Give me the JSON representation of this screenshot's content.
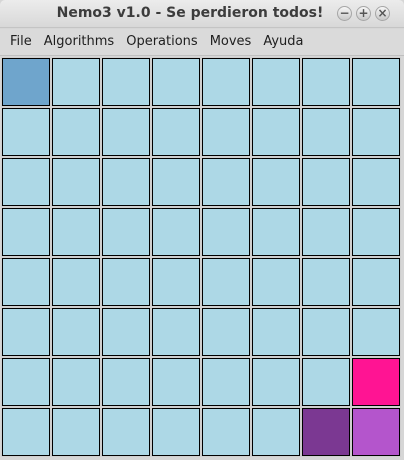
{
  "window": {
    "title": "Nemo3 v1.0 - Se perdieron todos!",
    "buttons": {
      "minimize": "−",
      "maximize": "+",
      "close": "×"
    }
  },
  "menubar": {
    "items": [
      {
        "label": "File"
      },
      {
        "label": "Algorithms"
      },
      {
        "label": "Operations"
      },
      {
        "label": "Moves"
      },
      {
        "label": "Ayuda"
      }
    ]
  },
  "board": {
    "colors": {
      "w": "#add8e6",
      "s": "#6fa5cc",
      "p": "#ff1493",
      "v": "#7b3892",
      "o": "#b455cc"
    },
    "rows": [
      [
        "s",
        "w",
        "w",
        "w",
        "w",
        "w",
        "w",
        "w"
      ],
      [
        "w",
        "w",
        "w",
        "w",
        "w",
        "w",
        "w",
        "w"
      ],
      [
        "w",
        "w",
        "w",
        "w",
        "w",
        "w",
        "w",
        "w"
      ],
      [
        "w",
        "w",
        "w",
        "w",
        "w",
        "w",
        "w",
        "w"
      ],
      [
        "w",
        "w",
        "w",
        "w",
        "w",
        "w",
        "w",
        "w"
      ],
      [
        "w",
        "w",
        "w",
        "w",
        "w",
        "w",
        "w",
        "w"
      ],
      [
        "w",
        "w",
        "w",
        "w",
        "w",
        "w",
        "w",
        "p"
      ],
      [
        "w",
        "w",
        "w",
        "w",
        "w",
        "w",
        "v",
        "o"
      ]
    ]
  }
}
